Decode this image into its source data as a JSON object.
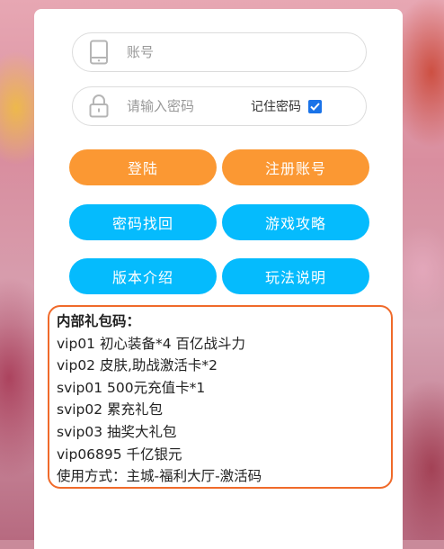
{
  "login": {
    "account_placeholder": "账号",
    "password_placeholder": "请输入密码",
    "remember_label": "记住密码",
    "remember_checked": true
  },
  "buttons": {
    "login": "登陆",
    "register": "注册账号",
    "recover_password": "密码找回",
    "game_guide": "游戏攻略",
    "version_intro": "版本介绍",
    "gameplay_help": "玩法说明"
  },
  "gift_box": {
    "title": "内部礼包码：",
    "lines": [
      "vip01 初心装备*4 百亿战斗力",
      "vip02 皮肤,助战激活卡*2",
      "svip01 500元充值卡*1",
      "svip02 累充礼包",
      "svip03 抽奖大礼包",
      "vip06895 千亿银元",
      "使用方式：主城-福利大厅-激活码"
    ]
  },
  "colors": {
    "orange_button": "#fb9833",
    "blue_button": "#05bbfd",
    "gift_border": "#f06a2a",
    "checkbox": "#1a73e8"
  },
  "icons": {
    "account": "phone-icon",
    "password": "lock-icon",
    "remember": "checkmark-icon"
  }
}
